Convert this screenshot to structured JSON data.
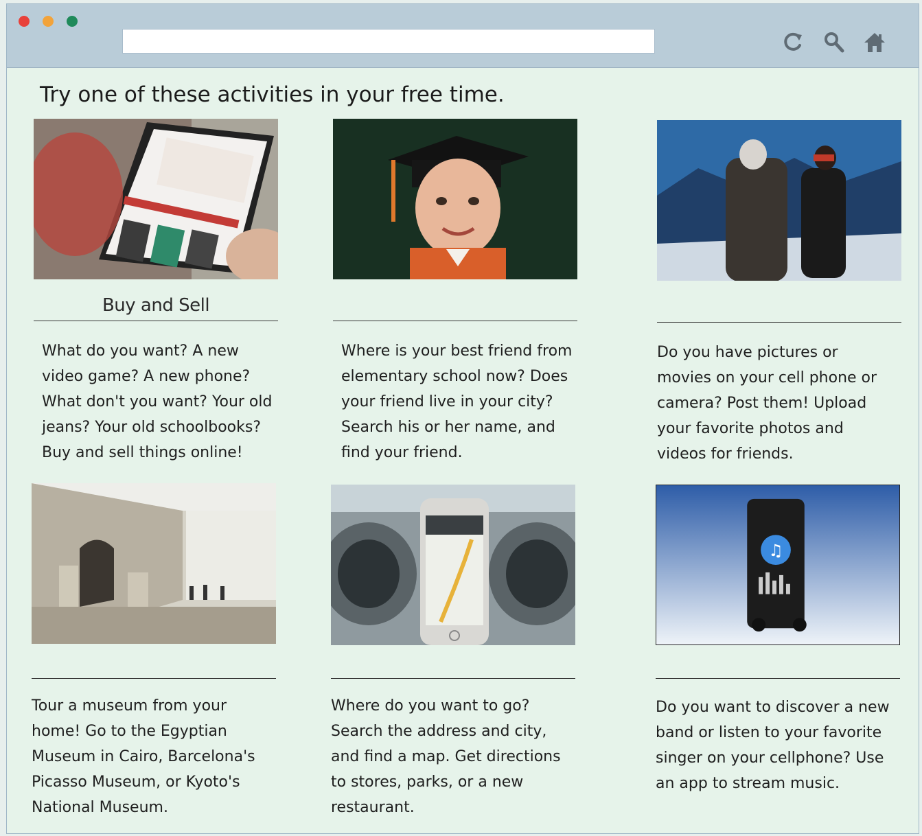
{
  "browser": {
    "url": "",
    "icons": [
      "reload-icon",
      "search-icon",
      "home-icon"
    ]
  },
  "page": {
    "headline": "Try one of these activities in your free time."
  },
  "cards": [
    {
      "caption": "Buy and Sell",
      "image": "tablet-shopping-photo",
      "lines": [
        "What do you want? A new",
        "video game? A new phone?",
        "What don't you want? Your old",
        "jeans? Your old schoolbooks?",
        "Buy and sell things online!"
      ]
    },
    {
      "caption": "",
      "image": "graduate-girl-photo",
      "lines": [
        "Where is your best friend from",
        "elementary school now? Does",
        "your friend live in your city?",
        "Search his or her name, and",
        "find your friend."
      ]
    },
    {
      "caption": "",
      "image": "mountain-photographers-photo",
      "lines": [
        "Do you have pictures or",
        "movies on your cell phone or",
        "camera? Post them! Upload",
        "your favorite photos and",
        "videos for friends."
      ]
    },
    {
      "caption": "",
      "image": "museum-hall-photo",
      "lines": [
        "Tour a museum from your",
        "home! Go to the Egyptian",
        "Museum in Cairo, Barcelona's",
        "Picasso Museum, or Kyoto's",
        "National Museum."
      ]
    },
    {
      "caption": "",
      "image": "car-phone-map-photo",
      "lines": [
        "Where do you want to go?",
        "Search the address and city,",
        "and find a map. Get directions",
        "to stores, parks, or a new",
        "restaurant."
      ]
    },
    {
      "caption": "",
      "image": "music-player-photo",
      "lines": [
        "Do you want to discover a new",
        "band or listen to your favorite",
        "singer on your cellphone? Use",
        "an app to stream music."
      ]
    }
  ]
}
